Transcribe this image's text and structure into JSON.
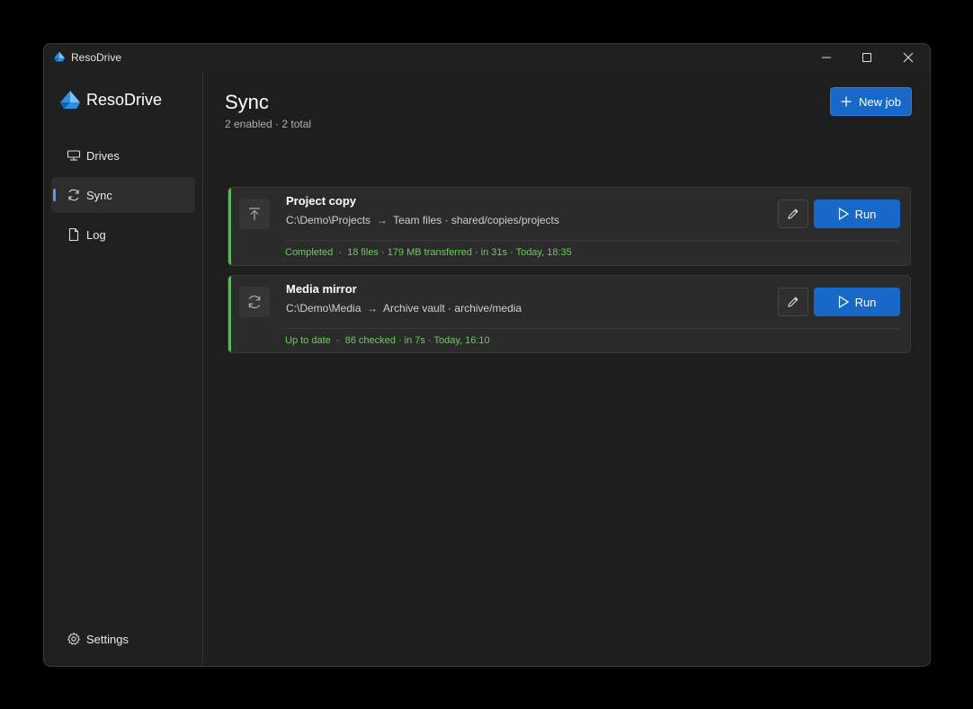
{
  "app": {
    "title": "ResoDrive"
  },
  "sidebar": {
    "brand": "ResoDrive",
    "items": [
      {
        "label": "Drives",
        "icon": "drives-icon"
      },
      {
        "label": "Sync",
        "icon": "sync-icon",
        "active": true
      },
      {
        "label": "Log",
        "icon": "document-icon"
      }
    ],
    "settings": {
      "label": "Settings",
      "icon": "gear-icon"
    }
  },
  "page": {
    "title": "Sync",
    "subtitle": "2 enabled · 2 total",
    "new_job_label": "New job"
  },
  "jobs": [
    {
      "name": "Project copy",
      "icon": "upload-icon",
      "path": "C:\\Demo\\Projects  →  Team files · shared/copies/projects",
      "status": "Completed  ·  18 files · 179 MB transferred · in 31s · Today, 18:35",
      "run_label": "Run"
    },
    {
      "name": "Media mirror",
      "icon": "sync-icon",
      "path": "C:\\Demo\\Media  →  Archive vault · archive/media",
      "status": "Up to date  ·  86 checked · in 7s · Today, 16:10",
      "run_label": "Run"
    }
  ],
  "colors": {
    "accent": "#1868c9",
    "success": "#6ccb5f",
    "background": "#1e1e1e"
  }
}
